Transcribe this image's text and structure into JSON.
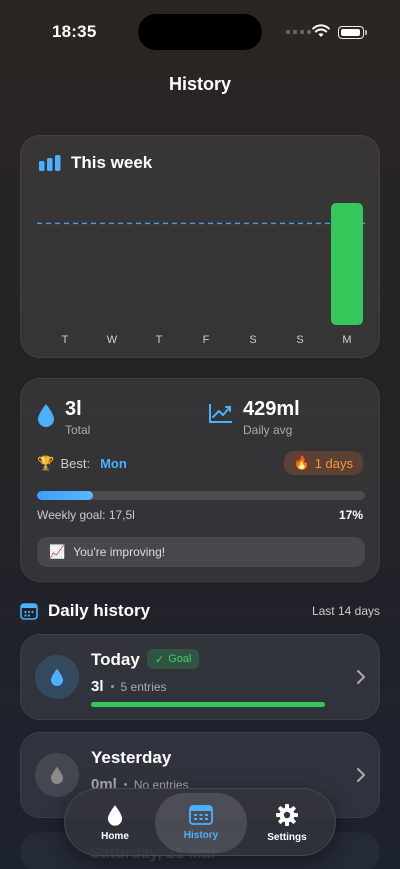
{
  "status": {
    "time": "18:35"
  },
  "page": {
    "title": "History"
  },
  "chart_data": {
    "type": "bar",
    "title": "This week",
    "categories": [
      "T",
      "W",
      "T",
      "F",
      "S",
      "S",
      "M"
    ],
    "values": [
      0,
      0,
      0,
      0,
      0,
      0,
      3000
    ],
    "goal_line": 2500,
    "ylim": [
      0,
      3000
    ],
    "unit": "ml",
    "colors": {
      "bar": "#34c759",
      "goal_line": "#4ab0ff"
    }
  },
  "stats": {
    "total_value": "3l",
    "total_label": "Total",
    "avg_value": "429ml",
    "avg_label": "Daily avg",
    "best_label": "Best:",
    "best_day": "Mon",
    "streak": "1 days",
    "goal_text": "Weekly goal: 17,5l",
    "goal_percent": "17%",
    "progress_fraction": 0.17,
    "improving_text": "You're improving!"
  },
  "history": {
    "title": "Daily history",
    "subtitle": "Last 14 days",
    "days": [
      {
        "name": "Today",
        "badge": "Goal",
        "amount": "3l",
        "entries": "5 entries",
        "progress_fraction": 1.0
      },
      {
        "name": "Yesterday",
        "amount": "0ml",
        "entries": "No entries"
      },
      {
        "name": "Saturday, 21 Mar"
      }
    ]
  },
  "tabs": [
    {
      "label": "Home",
      "icon": "drop-icon"
    },
    {
      "label": "History",
      "icon": "calendar-icon",
      "active": true
    },
    {
      "label": "Settings",
      "icon": "gear-icon"
    }
  ],
  "colors": {
    "accent": "#4ab0ff",
    "success": "#34c759",
    "streak": "#f39a3d"
  }
}
